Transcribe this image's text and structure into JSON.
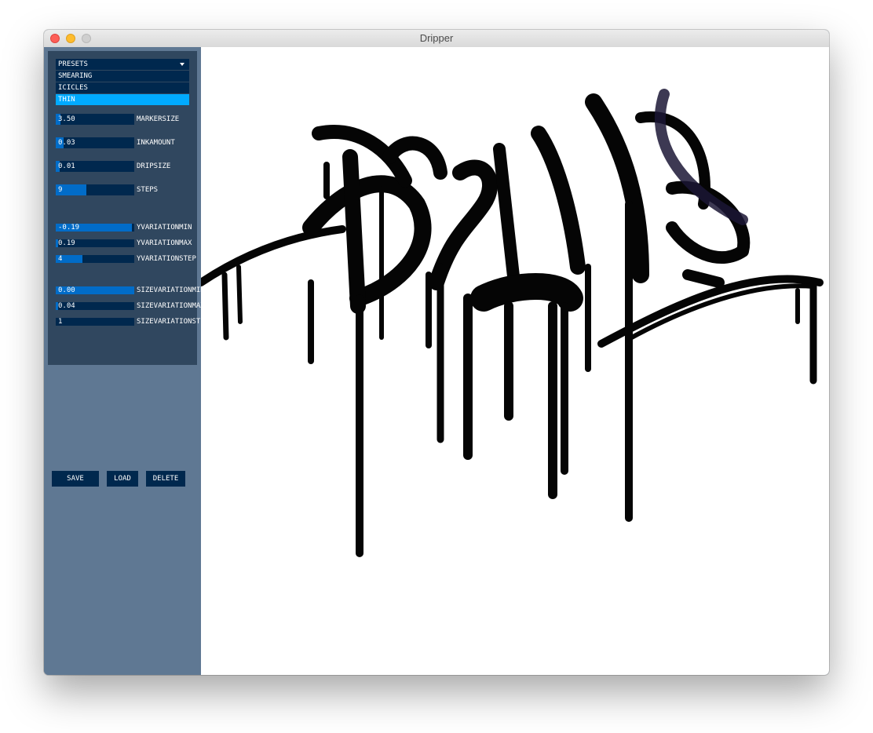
{
  "window": {
    "title": "Dripper"
  },
  "presets": {
    "header": "PRESETS",
    "items": [
      {
        "label": "SMEARING",
        "active": false
      },
      {
        "label": "ICICLES",
        "active": false
      },
      {
        "label": "THIN",
        "active": true
      }
    ]
  },
  "sliders": {
    "markersize": {
      "label": "MARKERSIZE",
      "value": "3.50",
      "fill": 0.06
    },
    "inkamount": {
      "label": "INKAMOUNT",
      "value": "0.03",
      "fill": 0.1
    },
    "dripsize": {
      "label": "DRIPSIZE",
      "value": "0.01",
      "fill": 0.05
    },
    "steps": {
      "label": "STEPS",
      "value": "9",
      "fill": 0.39
    },
    "yvariationmin": {
      "label": "YVARIATIONMIN",
      "value": "-0.19",
      "fill": 0.97
    },
    "yvariationmax": {
      "label": "YVARIATIONMAX",
      "value": "0.19",
      "fill": 0.03
    },
    "yvariationstep": {
      "label": "YVARIATIONSTEP",
      "value": "4",
      "fill": 0.34
    },
    "sizevariationmin": {
      "label": "SIZEVARIATIONMIN",
      "value": "0.00",
      "fill": 1.0
    },
    "sizevariationmax": {
      "label": "SIZEVARIATIONMAX",
      "value": "0.04",
      "fill": 0.03
    },
    "sizevariationstep": {
      "label": "SIZEVARIATIONSTEP",
      "value": "1",
      "fill": 0.0
    }
  },
  "buttons": {
    "save": "SAVE",
    "load": "LOAD",
    "delete": "DELETE"
  },
  "colors": {
    "sidebar": "#5f7893",
    "panel": "#30475f",
    "control_bg": "#00284e",
    "control_fill": "#016cc8",
    "active": "#00aaff"
  }
}
